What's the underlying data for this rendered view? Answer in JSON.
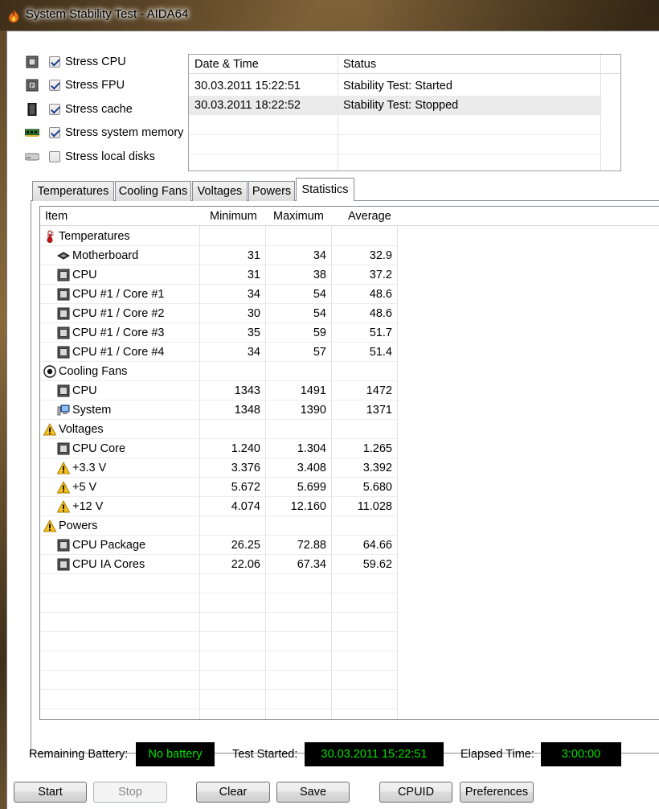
{
  "window": {
    "title": "System Stability Test - AIDA64"
  },
  "stress_options": [
    {
      "label": "Stress CPU",
      "checked": true,
      "icon": "cpu-icon"
    },
    {
      "label": "Stress FPU",
      "checked": true,
      "icon": "fpu-icon"
    },
    {
      "label": "Stress cache",
      "checked": true,
      "icon": "cache-icon"
    },
    {
      "label": "Stress system memory",
      "checked": true,
      "icon": "memory-icon"
    },
    {
      "label": "Stress local disks",
      "checked": false,
      "icon": "disk-icon"
    }
  ],
  "log": {
    "headers": [
      "Date & Time",
      "Status"
    ],
    "rows": [
      {
        "datetime": "30.03.2011 15:22:51",
        "status": "Stability Test: Started"
      },
      {
        "datetime": "30.03.2011 18:22:52",
        "status": "Stability Test: Stopped"
      }
    ]
  },
  "tabs": [
    {
      "label": "Temperatures",
      "active": false
    },
    {
      "label": "Cooling Fans",
      "active": false
    },
    {
      "label": "Voltages",
      "active": false
    },
    {
      "label": "Powers",
      "active": false
    },
    {
      "label": "Statistics",
      "active": true
    }
  ],
  "stats": {
    "headers": {
      "item": "Item",
      "min": "Minimum",
      "max": "Maximum",
      "avg": "Average"
    },
    "rows": [
      {
        "type": "group",
        "label": "Temperatures",
        "icon": "thermometer-icon"
      },
      {
        "type": "item",
        "label": "Motherboard",
        "icon": "motherboard-icon",
        "min": "31",
        "max": "34",
        "avg": "32.9"
      },
      {
        "type": "item",
        "label": "CPU",
        "icon": "cpu-chip-icon",
        "min": "31",
        "max": "38",
        "avg": "37.2"
      },
      {
        "type": "item",
        "label": "CPU #1 / Core #1",
        "icon": "cpu-chip-icon",
        "min": "34",
        "max": "54",
        "avg": "48.6"
      },
      {
        "type": "item",
        "label": "CPU #1 / Core #2",
        "icon": "cpu-chip-icon",
        "min": "30",
        "max": "54",
        "avg": "48.6"
      },
      {
        "type": "item",
        "label": "CPU #1 / Core #3",
        "icon": "cpu-chip-icon",
        "min": "35",
        "max": "59",
        "avg": "51.7"
      },
      {
        "type": "item",
        "label": "CPU #1 / Core #4",
        "icon": "cpu-chip-icon",
        "min": "34",
        "max": "57",
        "avg": "51.4"
      },
      {
        "type": "group",
        "label": "Cooling Fans",
        "icon": "fan-icon"
      },
      {
        "type": "item",
        "label": "CPU",
        "icon": "cpu-chip-icon",
        "min": "1343",
        "max": "1491",
        "avg": "1472"
      },
      {
        "type": "item",
        "label": "System",
        "icon": "computer-icon",
        "min": "1348",
        "max": "1390",
        "avg": "1371"
      },
      {
        "type": "group",
        "label": "Voltages",
        "icon": "warning-icon"
      },
      {
        "type": "item",
        "label": "CPU Core",
        "icon": "cpu-chip-icon",
        "min": "1.240",
        "max": "1.304",
        "avg": "1.265"
      },
      {
        "type": "item",
        "label": "+3.3 V",
        "icon": "warning-icon",
        "min": "3.376",
        "max": "3.408",
        "avg": "3.392"
      },
      {
        "type": "item",
        "label": "+5 V",
        "icon": "warning-icon",
        "min": "5.672",
        "max": "5.699",
        "avg": "5.680"
      },
      {
        "type": "item",
        "label": "+12 V",
        "icon": "warning-icon",
        "min": "4.074",
        "max": "12.160",
        "avg": "11.028"
      },
      {
        "type": "group",
        "label": "Powers",
        "icon": "warning-icon"
      },
      {
        "type": "item",
        "label": "CPU Package",
        "icon": "cpu-chip-icon",
        "min": "26.25",
        "max": "72.88",
        "avg": "64.66"
      },
      {
        "type": "item",
        "label": "CPU IA Cores",
        "icon": "cpu-chip-icon",
        "min": "22.06",
        "max": "67.34",
        "avg": "59.62"
      }
    ]
  },
  "status": {
    "battery_label": "Remaining Battery:",
    "battery_value": "No battery",
    "started_label": "Test Started:",
    "started_value": "30.03.2011 15:22:51",
    "elapsed_label": "Elapsed Time:",
    "elapsed_value": "3:00:00"
  },
  "buttons": {
    "start": "Start",
    "stop": "Stop",
    "clear": "Clear",
    "save": "Save",
    "cpuid": "CPUID",
    "preferences": "Preferences"
  },
  "colors": {
    "status_bg": "#000000",
    "status_text": "#00e000",
    "log_selected_row": "#ebebeb"
  }
}
